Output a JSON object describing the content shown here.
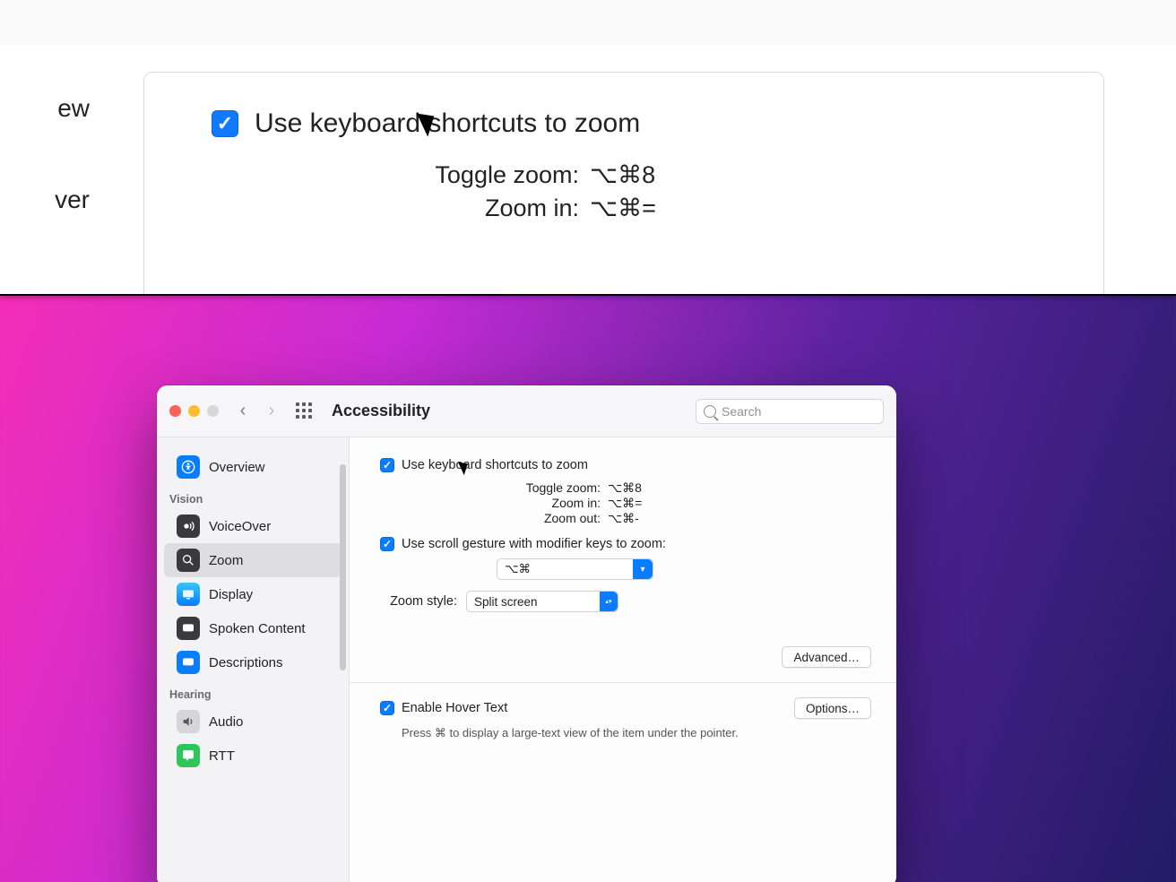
{
  "top_overlay": {
    "sidebar_frag_1": "ew",
    "sidebar_frag_2": "ver",
    "use_kb_label": "Use keyboard shortcuts to zoom",
    "shortcuts": {
      "toggle_label": "Toggle zoom:",
      "toggle_keys": "⌥⌘8",
      "in_label": "Zoom in:",
      "in_keys": "⌥⌘="
    }
  },
  "window": {
    "title": "Accessibility",
    "search_placeholder": "Search",
    "sidebar": {
      "overview": "Overview",
      "header_vision": "Vision",
      "voiceover": "VoiceOver",
      "zoom": "Zoom",
      "display": "Display",
      "spoken": "Spoken Content",
      "descriptions": "Descriptions",
      "header_hearing": "Hearing",
      "audio": "Audio",
      "rtt": "RTT"
    },
    "content": {
      "use_kb": "Use keyboard shortcuts to zoom",
      "shortcuts": {
        "toggle_label": "Toggle zoom:",
        "toggle_keys": "⌥⌘8",
        "in_label": "Zoom in:",
        "in_keys": "⌥⌘=",
        "out_label": "Zoom out:",
        "out_keys": "⌥⌘-"
      },
      "use_scroll": "Use scroll gesture with modifier keys to zoom:",
      "modifier_value": "⌥⌘",
      "zoom_style_label": "Zoom style:",
      "zoom_style_value": "Split screen",
      "advanced_btn": "Advanced…",
      "hover_label": "Enable Hover Text",
      "options_btn": "Options…",
      "hover_hint": "Press ⌘ to display a large-text view of the item under the pointer."
    }
  }
}
